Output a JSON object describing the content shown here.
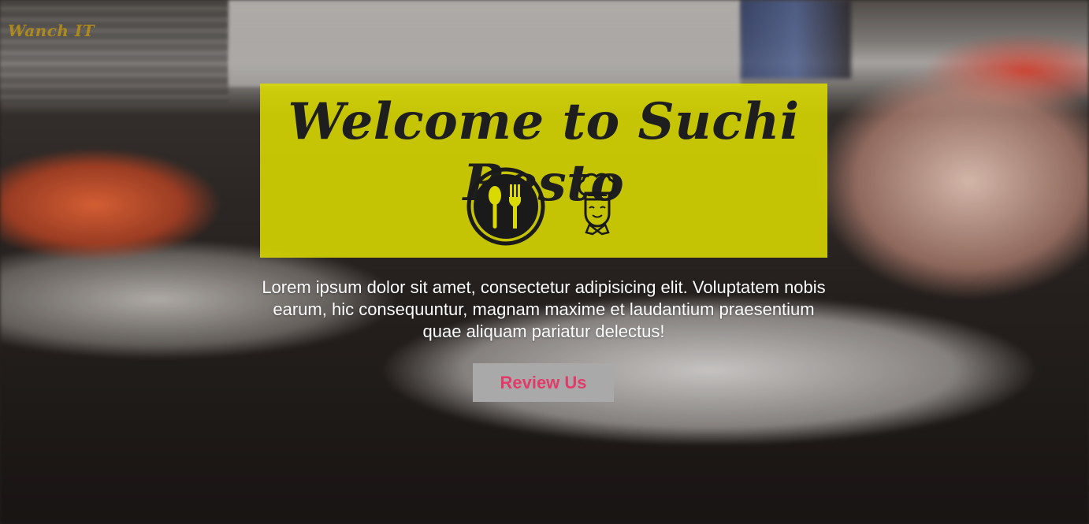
{
  "brand": {
    "logo_text": "Wanch IT"
  },
  "banner": {
    "title": "Welcome to Suchi Resto",
    "icons": [
      "plate-fork-spoon-icon",
      "chef-icon"
    ],
    "background_color": "#dada00"
  },
  "intro": {
    "text": "Lorem ipsum dolor sit amet, consectetur adipisicing elit. Voluptatem nobis earum, hic consequuntur, magnam maxime et laudantium praesentium quae aliquam pariatur delectus!"
  },
  "cta": {
    "review_label": "Review Us",
    "text_color": "#e23b6a",
    "background_color": "#a9a9a9"
  }
}
